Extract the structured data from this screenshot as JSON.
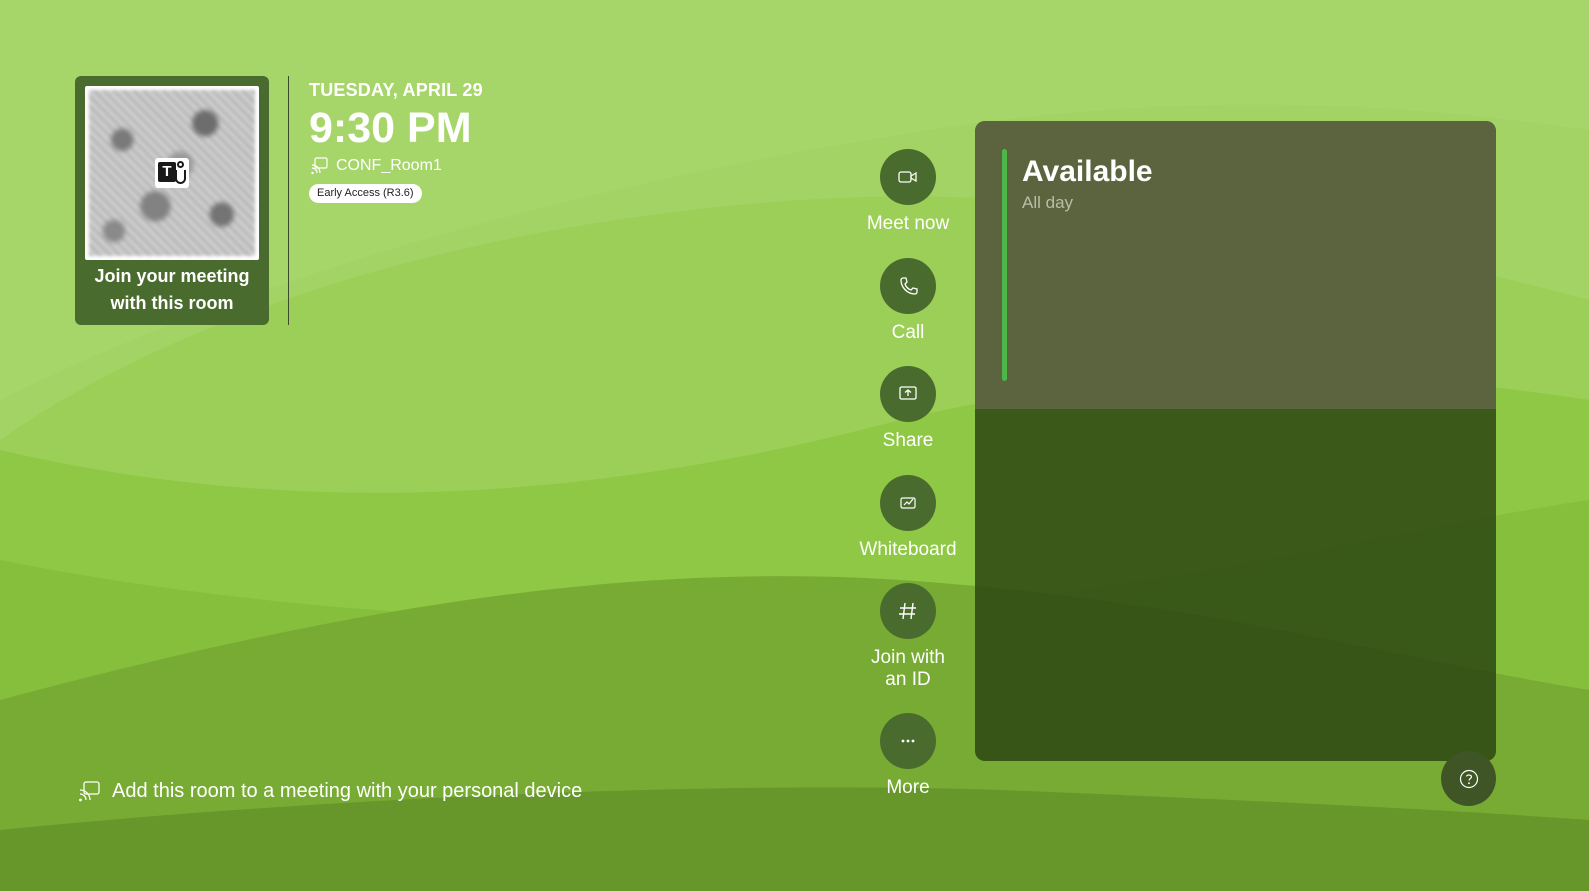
{
  "qr": {
    "caption_line1": "Join your meeting",
    "caption_line2": "with this room"
  },
  "header": {
    "date": "TUESDAY, APRIL 29",
    "time": "9:30 PM",
    "room_name": "CONF_Room1",
    "badge": "Early Access (R3.6)"
  },
  "actions": {
    "meet_now": "Meet now",
    "call": "Call",
    "share": "Share",
    "whiteboard": "Whiteboard",
    "join_id_line1": "Join with",
    "join_id_line2": "an ID",
    "more": "More"
  },
  "panel": {
    "status": "Available",
    "subtitle": "All day"
  },
  "footer": {
    "text": "Add this room to a meeting with your personal device"
  },
  "colors": {
    "accent": "#4cb648",
    "button_bg": "#4a6b2e",
    "background": "#8cc63e"
  }
}
